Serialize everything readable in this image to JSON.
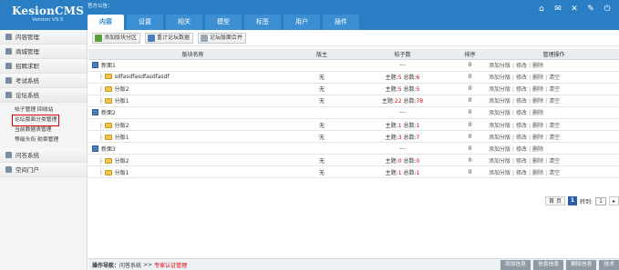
{
  "header": {
    "logo": "KesionCMS",
    "version": "Version V9.5",
    "notice": "官方公告：",
    "tabs": [
      "内容",
      "设置",
      "相关",
      "模型",
      "标签",
      "用户",
      "插件"
    ],
    "icons": [
      "home-icon",
      "mail-icon",
      "close-icon",
      "wrench-icon",
      "power-icon"
    ]
  },
  "sidebar": {
    "items": [
      {
        "label": "内容管理"
      },
      {
        "label": "商城管理"
      },
      {
        "label": "招聘求职"
      },
      {
        "label": "考试系统"
      },
      {
        "label": "论坛系统"
      }
    ],
    "submenu": [
      "帖子管理  回收站",
      "论坛版面分类管理",
      "当前数据表管理",
      "等级头衔  勋章管理"
    ],
    "items_after": [
      {
        "label": "问答系统"
      },
      {
        "label": "空间门户"
      }
    ]
  },
  "toolbar": {
    "add_section": "添加版块分区",
    "recount": "重计论坛数据",
    "merge": "论坛版面合并"
  },
  "table": {
    "headers": [
      "版块名称",
      "版主",
      "帖子数",
      "排序",
      "管理操作"
    ],
    "rows": [
      {
        "kind": "section",
        "name": "新面1",
        "mod": "",
        "posts": "---",
        "sort": "0",
        "ops": [
          "添加分版",
          "修改",
          "删除"
        ]
      },
      {
        "kind": "board",
        "name": "sdfasdfasdfasdfasdf",
        "mod": "无",
        "topics": "5",
        "total": "6",
        "sort": "0",
        "ops": [
          "添加分版",
          "修改",
          "删除",
          "清空"
        ]
      },
      {
        "kind": "board",
        "name": "分版2",
        "mod": "无",
        "topics": "5",
        "total": "5",
        "sort": "0",
        "ops": [
          "添加分版",
          "修改",
          "删除",
          "清空"
        ]
      },
      {
        "kind": "board",
        "name": "分版1",
        "mod": "无",
        "topics": "22",
        "total": "78",
        "sort": "0",
        "ops": [
          "添加分版",
          "修改",
          "删除",
          "清空"
        ]
      },
      {
        "kind": "section",
        "name": "新面2",
        "mod": "",
        "posts": "---",
        "sort": "0",
        "ops": [
          "添加分版",
          "修改",
          "删除"
        ]
      },
      {
        "kind": "board",
        "name": "分版2",
        "mod": "无",
        "topics": "1",
        "total": "1",
        "sort": "0",
        "ops": [
          "添加分版",
          "修改",
          "删除",
          "清空"
        ]
      },
      {
        "kind": "board",
        "name": "分版1",
        "mod": "无",
        "topics": "3",
        "total": "7",
        "sort": "0",
        "ops": [
          "添加分版",
          "修改",
          "删除",
          "清空"
        ]
      },
      {
        "kind": "section",
        "name": "新面3",
        "mod": "",
        "posts": "---",
        "sort": "0",
        "ops": [
          "添加分版",
          "修改",
          "删除"
        ]
      },
      {
        "kind": "board",
        "name": "分版2",
        "mod": "无",
        "topics": "0",
        "total": "0",
        "sort": "0",
        "ops": [
          "添加分版",
          "修改",
          "删除",
          "清空"
        ]
      },
      {
        "kind": "board",
        "name": "分版1",
        "mod": "无",
        "topics": "1",
        "total": "1",
        "sort": "0",
        "ops": [
          "添加分版",
          "修改",
          "删除",
          "清空"
        ]
      }
    ],
    "topics_label": "主题:",
    "total_label": "总数:"
  },
  "pager": {
    "first": "首 页",
    "current": "1",
    "goto_label": "转到:",
    "goto_value": "1"
  },
  "footer": {
    "nav_label": "操作导航：",
    "crumb1": "问答系统",
    "sep": ">>",
    "current": "专家认证管理",
    "buttons": [
      "添加信息",
      "信息信息",
      "删除信息",
      "技术"
    ]
  },
  "colors": {
    "header_bg": "#2a7fc4",
    "highlight": "#e1000a",
    "accent_numbers": "#e1000a"
  }
}
